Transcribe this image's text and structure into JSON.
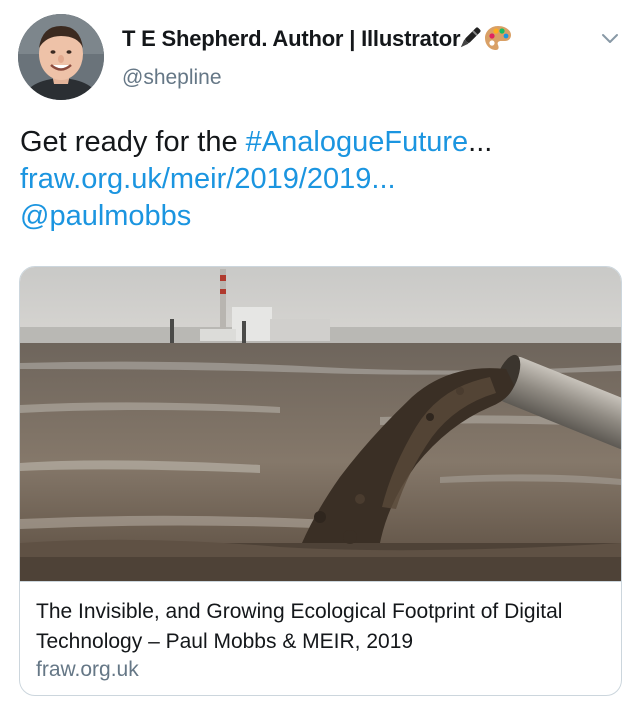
{
  "author": {
    "display_name": "T E Shepherd. Author | Illustrator",
    "handle": "@shepline",
    "name_icons": [
      "pen-icon",
      "artist-palette-icon"
    ],
    "avatar_icon": "avatar-photo"
  },
  "menu": {
    "icon": "chevron-down-icon"
  },
  "tweet": {
    "text_prefix": "Get ready for the ",
    "hashtag": "#AnalogueFuture",
    "ellipsis": "...",
    "url": "fraw.org.uk/meir/2019/2019...",
    "mention": "@paulmobbs"
  },
  "card": {
    "title": "The Invisible, and Growing Ecological Footprint of Digital Technology – Paul Mobbs & MEIR, 2019",
    "domain": "fraw.org.uk"
  },
  "colors": {
    "link": "#1b95e0",
    "text": "#14171a",
    "secondary": "#657786",
    "border": "#ccd6dd"
  }
}
